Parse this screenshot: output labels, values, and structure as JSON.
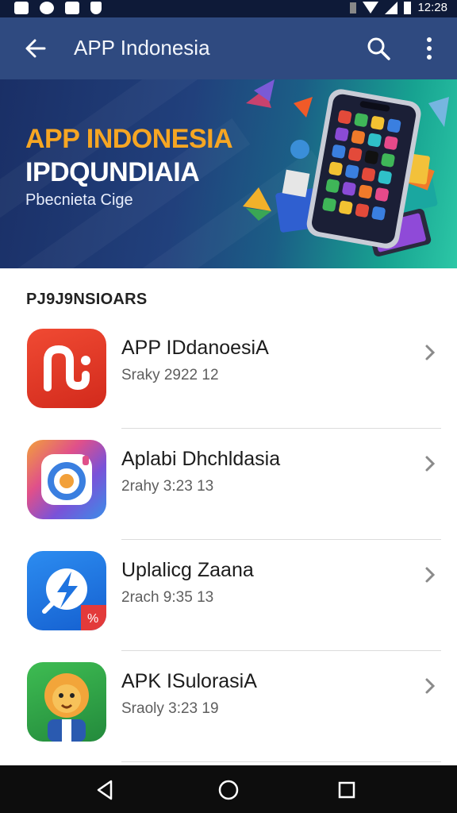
{
  "status_bar": {
    "time": "12:28",
    "icons": [
      "gallery-icon",
      "soccer-icon",
      "app-icon",
      "shield-icon",
      "vibrate-icon",
      "wifi-icon",
      "signal-icon",
      "battery-icon"
    ]
  },
  "app_bar": {
    "title": "APP Indonesia",
    "back_icon": "arrow-back-icon",
    "search_icon": "search-icon",
    "more_icon": "more-vert-icon"
  },
  "banner": {
    "title_line1": "APP INDONESIA",
    "title_line2": "IPDQUNDIAIA",
    "subtitle": "Pbecnieta Cige",
    "colors": {
      "accent": "#f6a623",
      "title": "#ffffff"
    }
  },
  "section": {
    "title": "PJ9J9NSIOARS"
  },
  "apps": [
    {
      "name": "APP IDdanoesiA",
      "subtitle": "Sraky 2922 12",
      "icon": "red-n-app-icon",
      "color": "#e53b2a"
    },
    {
      "name": "Aplabi Dhchldasia",
      "subtitle": "2rahy 3:23 13",
      "icon": "camera-app-icon",
      "color": "#4a67d6"
    },
    {
      "name": "Uplalicg Zaana",
      "subtitle": "2rach 9:35 13",
      "icon": "bolt-app-icon",
      "color": "#1e73e0"
    },
    {
      "name": "APK ISulorasiA",
      "subtitle": "Sraoly 3:23 19",
      "icon": "lion-app-icon",
      "color": "#2fa24a"
    }
  ],
  "nav_bar": {
    "back": "nav-back-icon",
    "home": "nav-home-icon",
    "recents": "nav-recents-icon"
  }
}
